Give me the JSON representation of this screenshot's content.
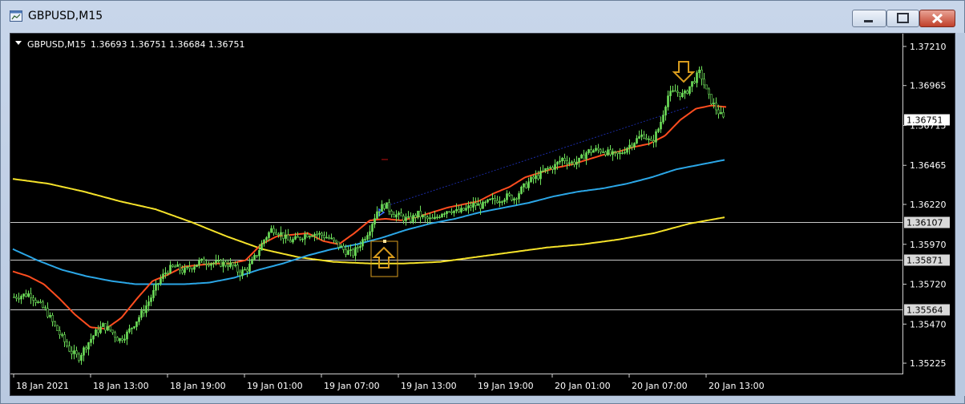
{
  "window": {
    "title": "GBPUSD,M15",
    "buttons": [
      "minimize",
      "maximize",
      "close"
    ]
  },
  "chart_header": {
    "symbol_tf": "GBPUSD,M15",
    "ohlc": "1.36693 1.36751 1.36684 1.36751"
  },
  "chart_data": {
    "type": "candlestick",
    "symbol": "GBPUSD",
    "timeframe": "M15",
    "price_axis": {
      "ticks": [
        "1.37210",
        "1.36965",
        "1.36715",
        "1.36465",
        "1.36220",
        "1.35970",
        "1.35720",
        "1.35470",
        "1.35225"
      ],
      "ylim": [
        1.3516,
        1.3727
      ]
    },
    "time_axis": {
      "ticks": [
        "18 Jan 2021",
        "18 Jan 13:00",
        "18 Jan 19:00",
        "19 Jan 01:00",
        "19 Jan 07:00",
        "19 Jan 13:00",
        "19 Jan 19:00",
        "20 Jan 01:00",
        "20 Jan 07:00",
        "20 Jan 13:00"
      ]
    },
    "current_price": "1.36751",
    "horizontal_levels": [
      {
        "label": "1.36107",
        "value": 1.36107
      },
      {
        "label": "1.35871",
        "value": 1.35871
      },
      {
        "label": "1.35564",
        "value": 1.35564
      }
    ],
    "close_path": [
      1.3564,
      1.3565,
      1.3566,
      1.356,
      1.3555,
      1.3546,
      1.3538,
      1.353,
      1.3526,
      1.3534,
      1.3541,
      1.3546,
      1.3543,
      1.3537,
      1.3541,
      1.3548,
      1.3555,
      1.3564,
      1.3574,
      1.3581,
      1.3583,
      1.358,
      1.3583,
      1.3586,
      1.3586,
      1.3585,
      1.3585,
      1.3584,
      1.3579,
      1.3582,
      1.359,
      1.36,
      1.3607,
      1.3604,
      1.3599,
      1.36,
      1.3603,
      1.3604,
      1.3603,
      1.3601,
      1.3597,
      1.3593,
      1.3591,
      1.3598,
      1.3606,
      1.3618,
      1.3622,
      1.3616,
      1.3614,
      1.3612,
      1.3616,
      1.3613,
      1.3612,
      1.3617,
      1.3619,
      1.3617,
      1.3619,
      1.3622,
      1.3621,
      1.3624,
      1.3625,
      1.3627,
      1.3626,
      1.3632,
      1.3637,
      1.364,
      1.3644,
      1.3646,
      1.3651,
      1.3648,
      1.3649,
      1.3655,
      1.3656,
      1.3656,
      1.3653,
      1.3653,
      1.3658,
      1.3662,
      1.3666,
      1.366,
      1.3671,
      1.369,
      1.3693,
      1.369,
      1.3698,
      1.3705,
      1.369,
      1.3682,
      1.3675
    ],
    "ma_red_path": [
      1.358,
      1.3577,
      1.3572,
      1.3563,
      1.3553,
      1.3545,
      1.3544,
      1.3551,
      1.3563,
      1.3574,
      1.3578,
      1.3583,
      1.3584,
      1.3585,
      1.3585,
      1.3587,
      1.3597,
      1.3602,
      1.3603,
      1.3604,
      1.3599,
      1.3597,
      1.3604,
      1.3612,
      1.3613,
      1.3612,
      1.3614,
      1.3617,
      1.362,
      1.3622,
      1.3624,
      1.3629,
      1.3633,
      1.3639,
      1.3642,
      1.3645,
      1.3647,
      1.365,
      1.3653,
      1.3655,
      1.3658,
      1.366,
      1.3665,
      1.3675,
      1.3682,
      1.3684,
      1.3683
    ],
    "ma_blue_path": [
      1.3594,
      1.3587,
      1.3581,
      1.3577,
      1.3574,
      1.3572,
      1.3572,
      1.3572,
      1.3573,
      1.3576,
      1.3581,
      1.3585,
      1.359,
      1.3594,
      1.3597,
      1.3601,
      1.3606,
      1.361,
      1.3613,
      1.3617,
      1.362,
      1.3623,
      1.3627,
      1.363,
      1.3632,
      1.3635,
      1.3639,
      1.3644,
      1.3647,
      1.365
    ],
    "ma_yellow_path": [
      1.3638,
      1.3635,
      1.363,
      1.3624,
      1.3619,
      1.3611,
      1.3602,
      1.3594,
      1.3589,
      1.3586,
      1.3585,
      1.3585,
      1.3586,
      1.3589,
      1.3592,
      1.3595,
      1.3597,
      1.36,
      1.3604,
      1.361,
      1.3614
    ],
    "colors": {
      "candles": "#6ee05a",
      "ma_red": "#ff4d1f",
      "ma_blue": "#2ba6e6",
      "ma_yellow": "#f5e22a",
      "level_lines": "#c8c8c8",
      "trend_line": "#1a2aa0",
      "arrows": "#d79b1e"
    }
  }
}
